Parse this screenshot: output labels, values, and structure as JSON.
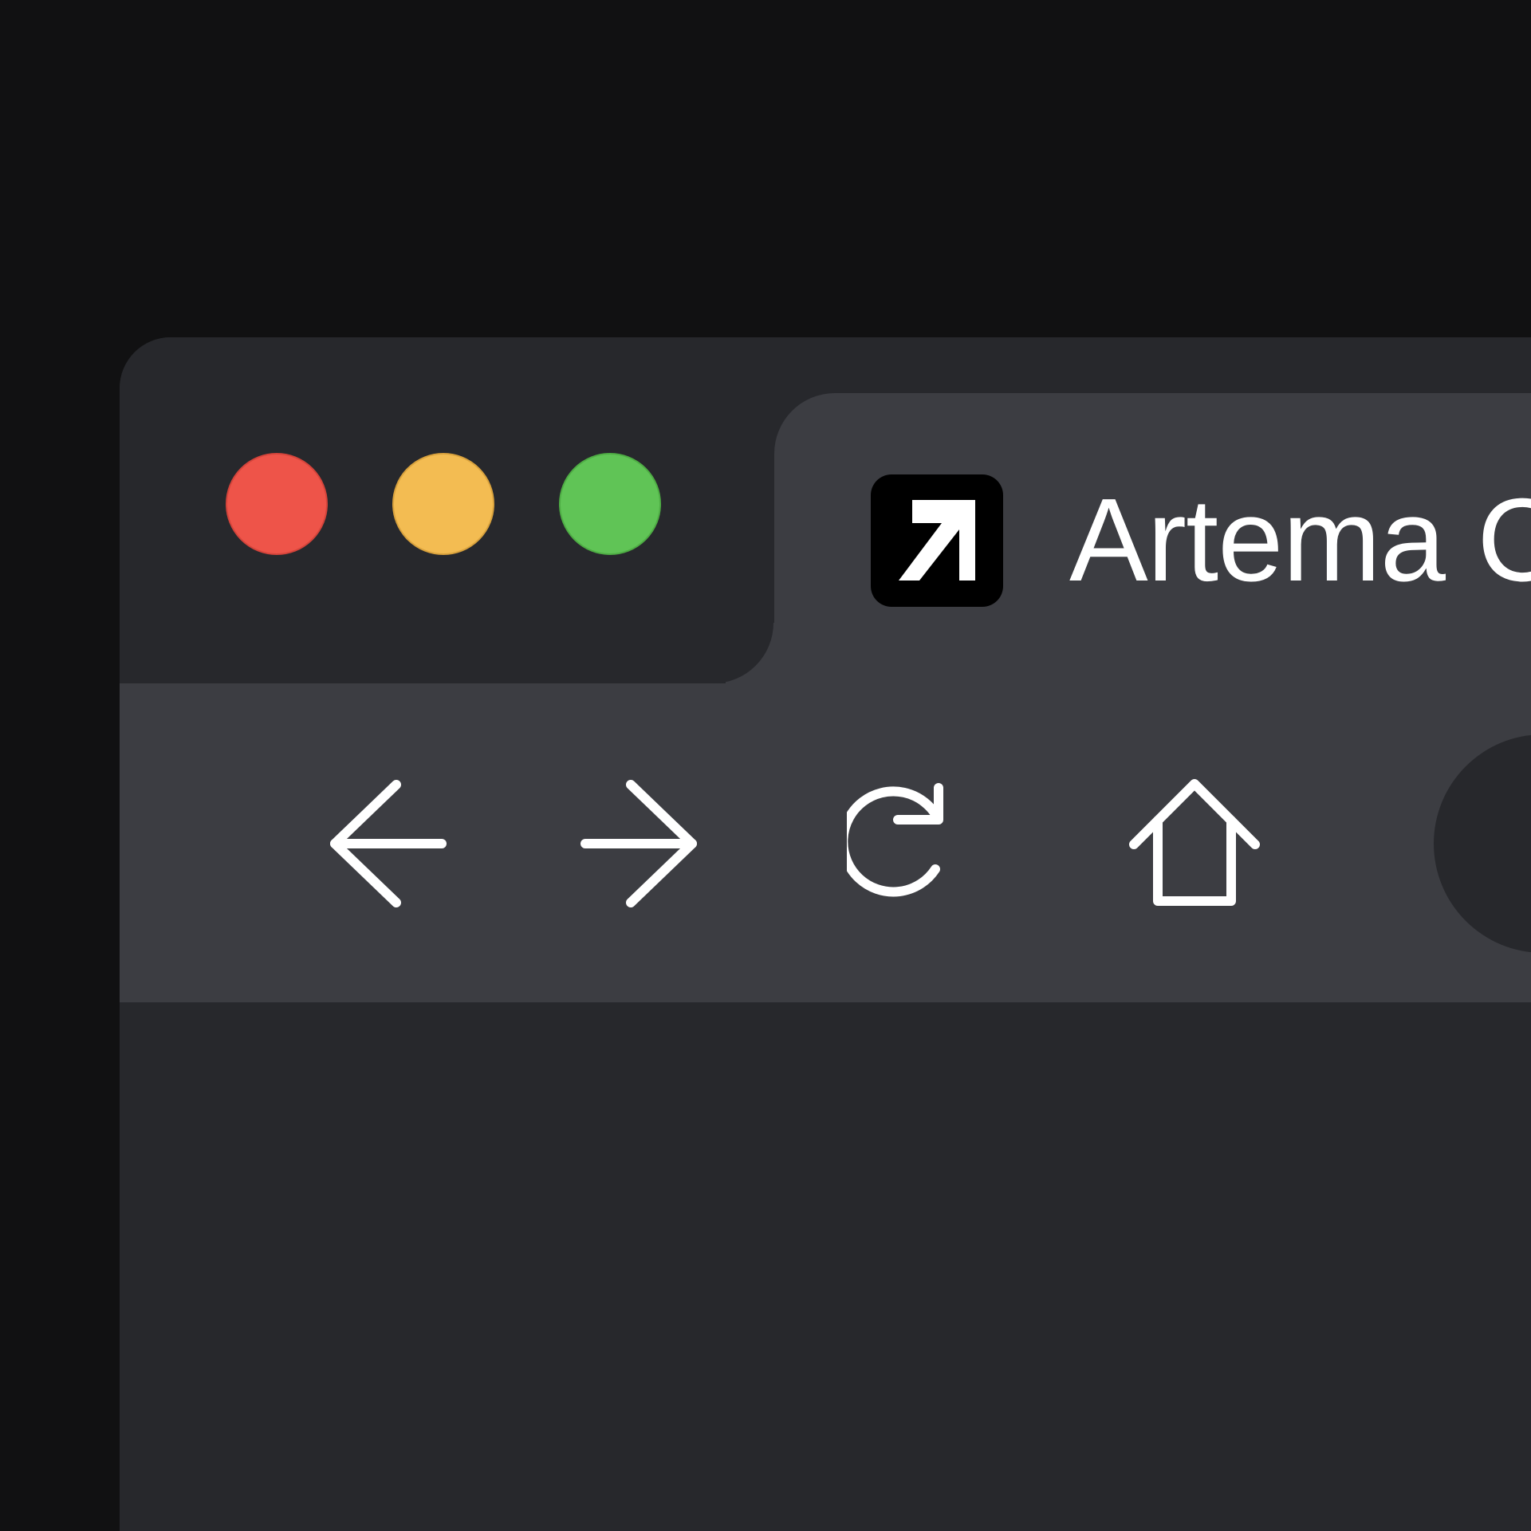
{
  "window": {
    "traffic_lights": {
      "close": {
        "color": "#ee5449",
        "border": "#d5443b"
      },
      "minimize": {
        "color": "#f3bc52",
        "border": "#d9a23d"
      },
      "zoom": {
        "color": "#60c456",
        "border": "#4ead44"
      }
    },
    "tab": {
      "title": "Artema Co",
      "favicon": "arrow-up-right-icon"
    },
    "toolbar": {
      "back_icon": "arrow-left-icon",
      "forward_icon": "arrow-right-icon",
      "reload_icon": "reload-icon",
      "home_icon": "home-icon"
    },
    "colors": {
      "desktop": "#111112",
      "chrome": "#27282c",
      "tab_active": "#3c3d42",
      "icon": "#ffffff"
    }
  }
}
